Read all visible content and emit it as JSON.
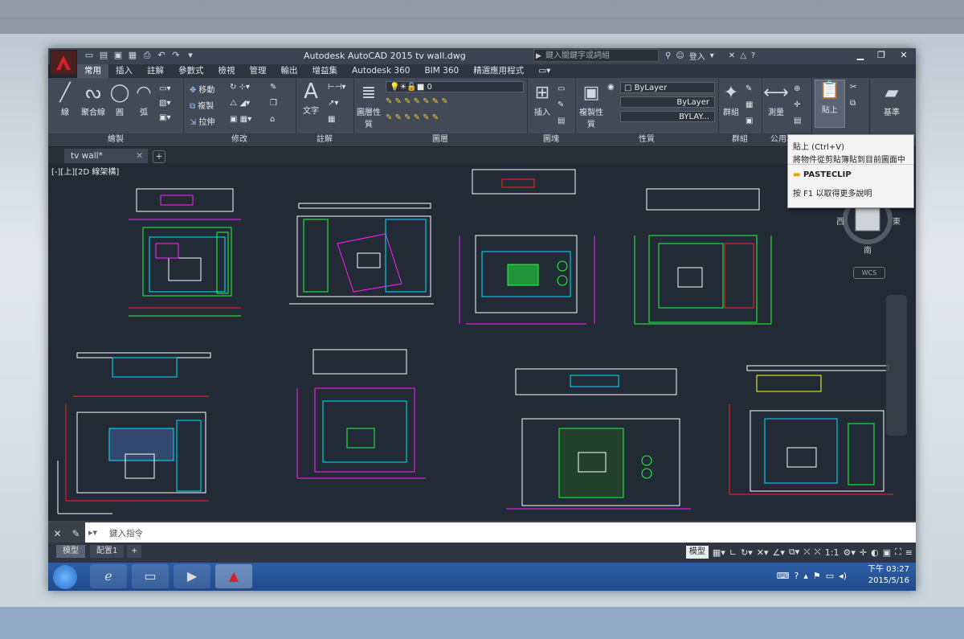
{
  "window": {
    "title": "Autodesk AutoCAD 2015    tv wall.dwg",
    "search_placeholder": "鍵入關鍵字或詞組",
    "login": "登入",
    "help": "?"
  },
  "ribbon_tabs": [
    "常用",
    "插入",
    "註解",
    "參數式",
    "檢視",
    "管理",
    "輸出",
    "增益集",
    "Autodesk 360",
    "BIM 360",
    "精選應用程式"
  ],
  "panels": {
    "draw": {
      "label": "繪製",
      "tools": [
        "線",
        "聚合線",
        "圓",
        "弧"
      ]
    },
    "modify": {
      "label": "修改",
      "tools": [
        "移動",
        "複製",
        "拉伸"
      ]
    },
    "annotation": {
      "label": "註解",
      "tools": [
        "文字"
      ]
    },
    "layers": {
      "label": "圖層",
      "tools": [
        "圖層性質"
      ],
      "current": "0"
    },
    "block": {
      "label": "圖塊",
      "tools": [
        "插入"
      ]
    },
    "properties": {
      "label": "性質",
      "tools": [
        "複製性質"
      ],
      "color": "ByLayer",
      "linetype": "ByLayer",
      "lineweight": "BYLAY..."
    },
    "groups": {
      "label": "群組",
      "tools": [
        "群組"
      ]
    },
    "utilities": {
      "label": "公用程式",
      "tools": [
        "測量"
      ]
    },
    "clipboard": {
      "tools": [
        "貼上"
      ]
    },
    "base": {
      "tools": [
        "基準"
      ]
    }
  },
  "tooltip": {
    "title": "貼上 (Ctrl+V)",
    "desc": "將物件從剪貼簿貼到目前圖面中",
    "command": "PASTECLIP",
    "help": "按 F1 以取得更多說明"
  },
  "doc_tab": "tv wall*",
  "viewport_label": "[-][上][2D 線架構]",
  "viewcube": {
    "west": "西",
    "east": "東",
    "south": "南",
    "wcs": "WCS"
  },
  "command_line": {
    "placeholder": "鍵入指令"
  },
  "layout_tabs": [
    "模型",
    "配置1"
  ],
  "status": {
    "model": "模型",
    "scale": "1:1"
  },
  "taskbar": {
    "time": "下午 03:27",
    "date": "2015/5/16"
  },
  "colors": {
    "accent": "#c8102e",
    "canvas": "#222a35",
    "cyan": "#00e5ff",
    "green": "#22ff44",
    "magenta": "#ff22ff",
    "red": "#ff2222",
    "yellow": "#ffff33",
    "white": "#ffffff"
  }
}
